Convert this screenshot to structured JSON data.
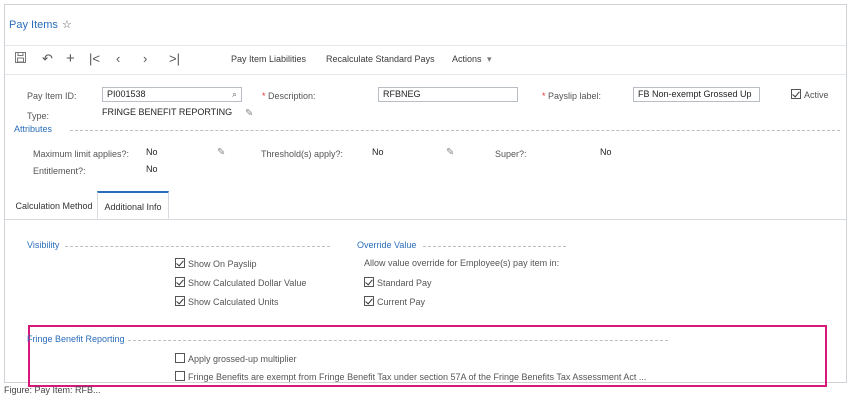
{
  "header": {
    "title": "Pay Items",
    "favorite_icon": "star-outline-icon"
  },
  "toolbar": {
    "icons": [
      "save-icon",
      "undo-icon",
      "add-icon",
      "first-record-icon",
      "previous-record-icon",
      "next-record-icon",
      "last-record-icon"
    ],
    "pay_item_liabilities": "Pay Item Liabilities",
    "recalculate": "Recalculate Standard Pays",
    "actions": "Actions",
    "actions_caret": "▾"
  },
  "form": {
    "pay_item_id_label": "Pay Item ID:",
    "pay_item_id_value": "PI001538",
    "description_label": "Description:",
    "description_value": "RFBNEG",
    "payslip_label_label": "Payslip label:",
    "payslip_label_value": "FB Non-exempt Grossed Up",
    "active_label": "Active",
    "active_checked": true,
    "type_label": "Type:",
    "type_value": "FRINGE BENEFIT REPORTING",
    "required_marker": "*"
  },
  "attributes": {
    "title": "Attributes",
    "max_limit_label": "Maximum limit applies?:",
    "max_limit_value": "No",
    "threshold_label": "Threshold(s) apply?:",
    "threshold_value": "No",
    "super_label": "Super?:",
    "super_value": "No",
    "entitlement_label": "Entitlement?:",
    "entitlement_value": "No"
  },
  "tabs": [
    {
      "label": "Calculation Method",
      "active": false
    },
    {
      "label": "Additional Info",
      "active": true
    }
  ],
  "visibility": {
    "title": "Visibility",
    "show_on_payslip": "Show On Payslip",
    "show_calc_dollar": "Show Calculated Dollar Value",
    "show_calc_units": "Show Calculated Units"
  },
  "override": {
    "title": "Override Value",
    "description": "Allow value override for Employee(s) pay item in:",
    "standard_pay": "Standard Pay",
    "current_pay": "Current Pay"
  },
  "fringe": {
    "title": "Fringe Benefit Reporting",
    "apply_multiplier": "Apply grossed-up multiplier",
    "exempt": "Fringe Benefits are exempt from Fringe Benefit Tax under section 57A of the Fringe Benefits Tax Assessment Act ..."
  },
  "caption": "Figure: Pay Item: RFB...",
  "colors": {
    "accent": "#2a6ebb",
    "highlight": "#d6187a",
    "required": "#dd3333"
  }
}
